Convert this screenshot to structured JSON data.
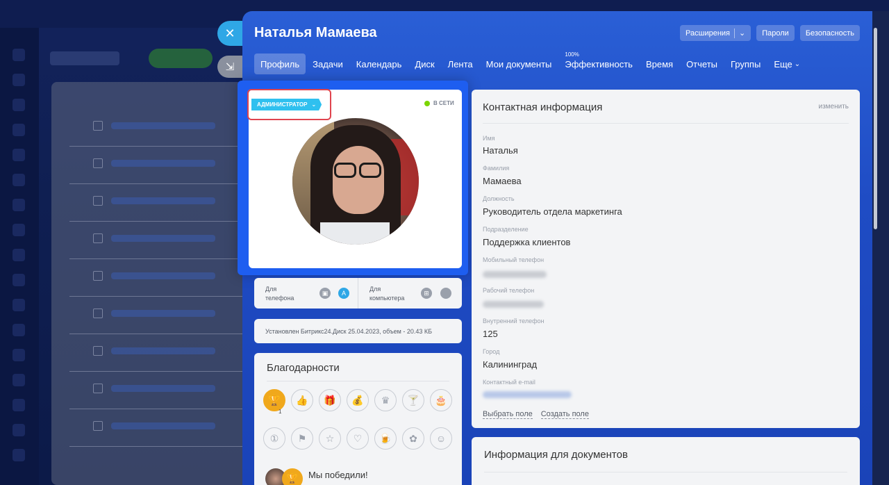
{
  "slider": {
    "title": "Наталья Мамаева",
    "header_buttons": {
      "extensions": "Расширения",
      "passwords": "Пароли",
      "security": "Безопасность"
    },
    "tabs": [
      {
        "label": "Профиль",
        "active": true
      },
      {
        "label": "Задачи"
      },
      {
        "label": "Календарь"
      },
      {
        "label": "Диск"
      },
      {
        "label": "Лента"
      },
      {
        "label": "Мои документы"
      },
      {
        "label": "Эффективность",
        "superscript": "100%"
      },
      {
        "label": "Время"
      },
      {
        "label": "Отчеты"
      },
      {
        "label": "Группы"
      },
      {
        "label": "Еще"
      }
    ]
  },
  "profile": {
    "role_badge": "АДМИНИСТРАТОР",
    "status": "В СЕТИ",
    "status_color": "#7bd500",
    "role_color": "#2fc0ef",
    "highlight_color": "#e0444e"
  },
  "apps": {
    "phone_label_1": "Для",
    "phone_label_2": "телефона",
    "computer_label_1": "Для",
    "computer_label_2": "компьютера",
    "phone_icons": [
      "android-icon",
      "appstore-icon"
    ],
    "computer_icons": [
      "windows-icon",
      "apple-icon"
    ]
  },
  "disk": {
    "text": "Установлен Битрикс24.Диск 25.04.2023, объем - 20.43 КБ"
  },
  "thanks": {
    "title": "Благодарности",
    "badges_row1": [
      "trophy-icon",
      "thumbs-up-icon",
      "gift-icon",
      "money-bag-icon",
      "crown-icon",
      "cocktail-icon",
      "cake-icon"
    ],
    "badges_row2": [
      "number-one-icon",
      "flag-icon",
      "star-icon",
      "heart-icon",
      "beer-icon",
      "flower-icon",
      "smile-icon"
    ],
    "trophy_count": "1",
    "latest": "Мы победили!"
  },
  "contact": {
    "title": "Контактная информация",
    "edit": "изменить",
    "fields": {
      "name_label": "Имя",
      "name_value": "Наталья",
      "surname_label": "Фамилия",
      "surname_value": "Мамаева",
      "position_label": "Должность",
      "position_value": "Руководитель отдела маркетинга",
      "department_label": "Подразделение",
      "department_value": "Поддержка клиентов",
      "mobile_label": "Мобильный телефон",
      "work_phone_label": "Рабочий телефон",
      "internal_phone_label": "Внутренний телефон",
      "internal_phone_value": "125",
      "city_label": "Город",
      "city_value": "Калининград",
      "email_label": "Контактный e-mail"
    },
    "choose_field": "Выбрать поле",
    "create_field": "Создать поле"
  },
  "documents": {
    "title": "Информация для документов"
  }
}
